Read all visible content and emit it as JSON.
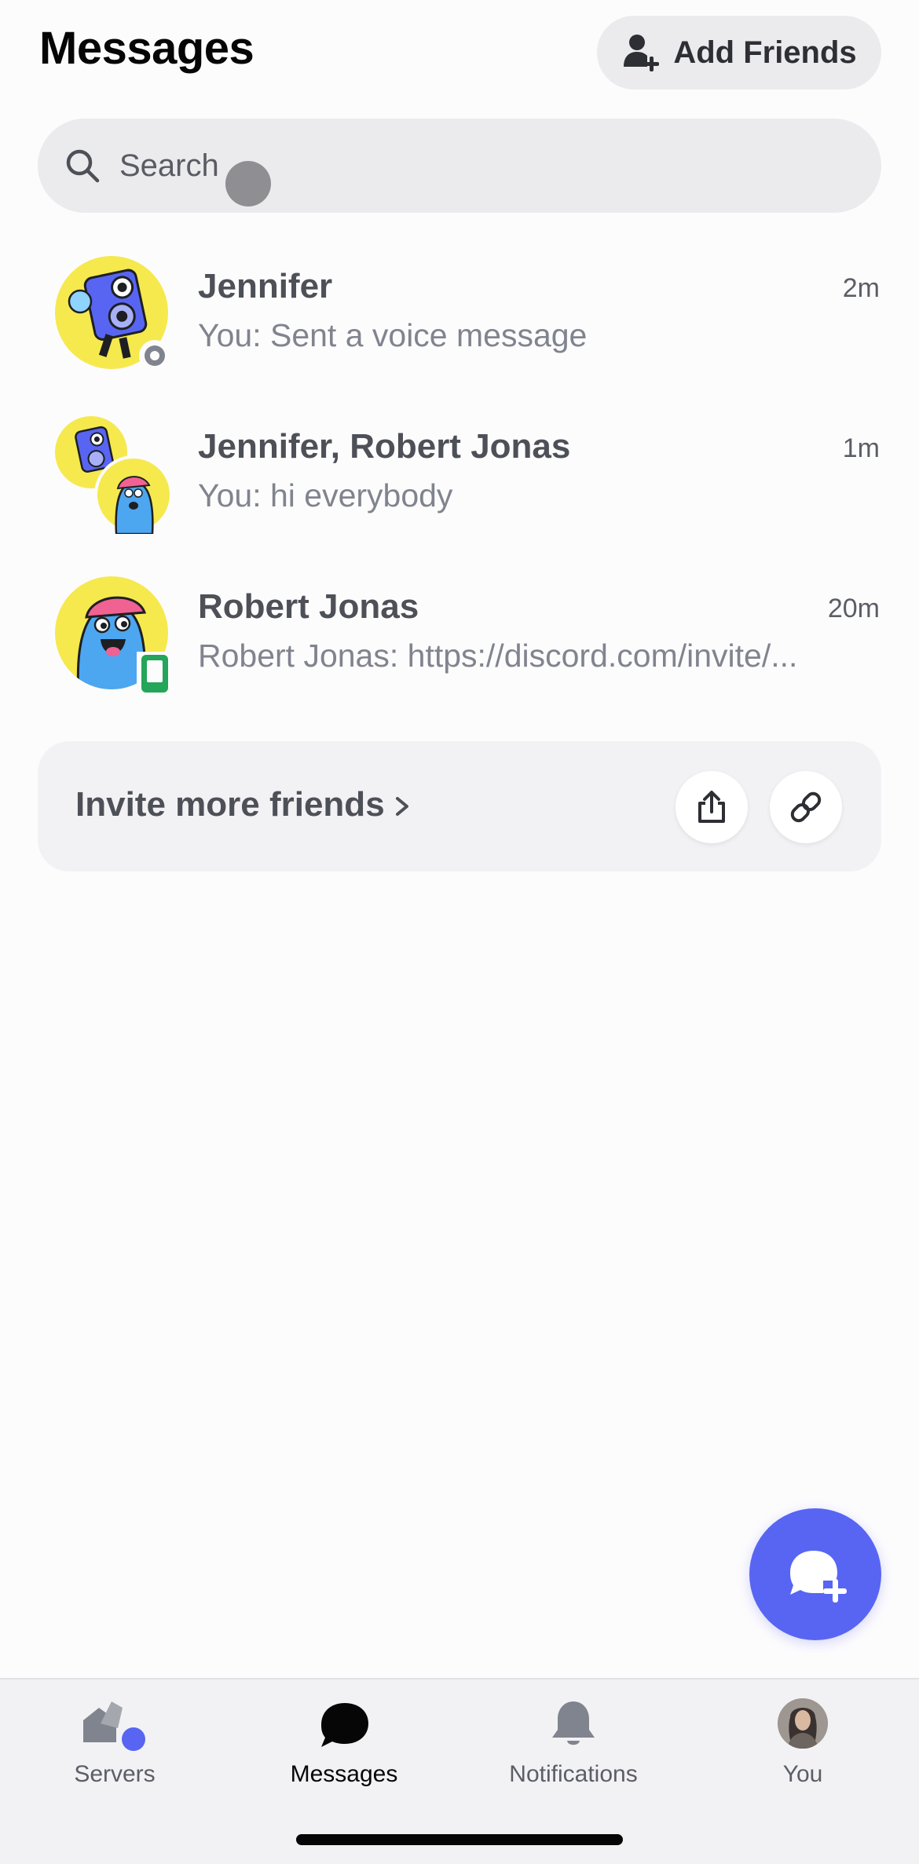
{
  "header": {
    "title": "Messages",
    "add_friends_label": "Add Friends"
  },
  "search": {
    "placeholder": "Search"
  },
  "conversations": [
    {
      "name": "Jennifer",
      "time": "2m",
      "preview": "You: Sent a voice message",
      "avatar": "speaker-character-avatar",
      "status": "offline"
    },
    {
      "name": "Jennifer, Robert Jonas",
      "time": "1m",
      "preview": "You: hi everybody",
      "avatar": "group-avatar"
    },
    {
      "name": "Robert Jonas",
      "time": "20m",
      "preview": "Robert Jonas: https://discord.com/invite/...",
      "avatar": "blue-creature-avatar",
      "status": "mobile-online"
    }
  ],
  "invite": {
    "label": "Invite more friends"
  },
  "tabs": [
    {
      "label": "Servers",
      "icon": "servers-icon",
      "active": false
    },
    {
      "label": "Messages",
      "icon": "messages-icon",
      "active": true
    },
    {
      "label": "Notifications",
      "icon": "bell-icon",
      "active": false
    },
    {
      "label": "You",
      "icon": "profile-avatar",
      "active": false
    }
  ],
  "colors": {
    "accent": "#5865f2",
    "online_mobile": "#23a55a",
    "offline": "#80848e",
    "avatar_yellow": "#f5e94e"
  }
}
